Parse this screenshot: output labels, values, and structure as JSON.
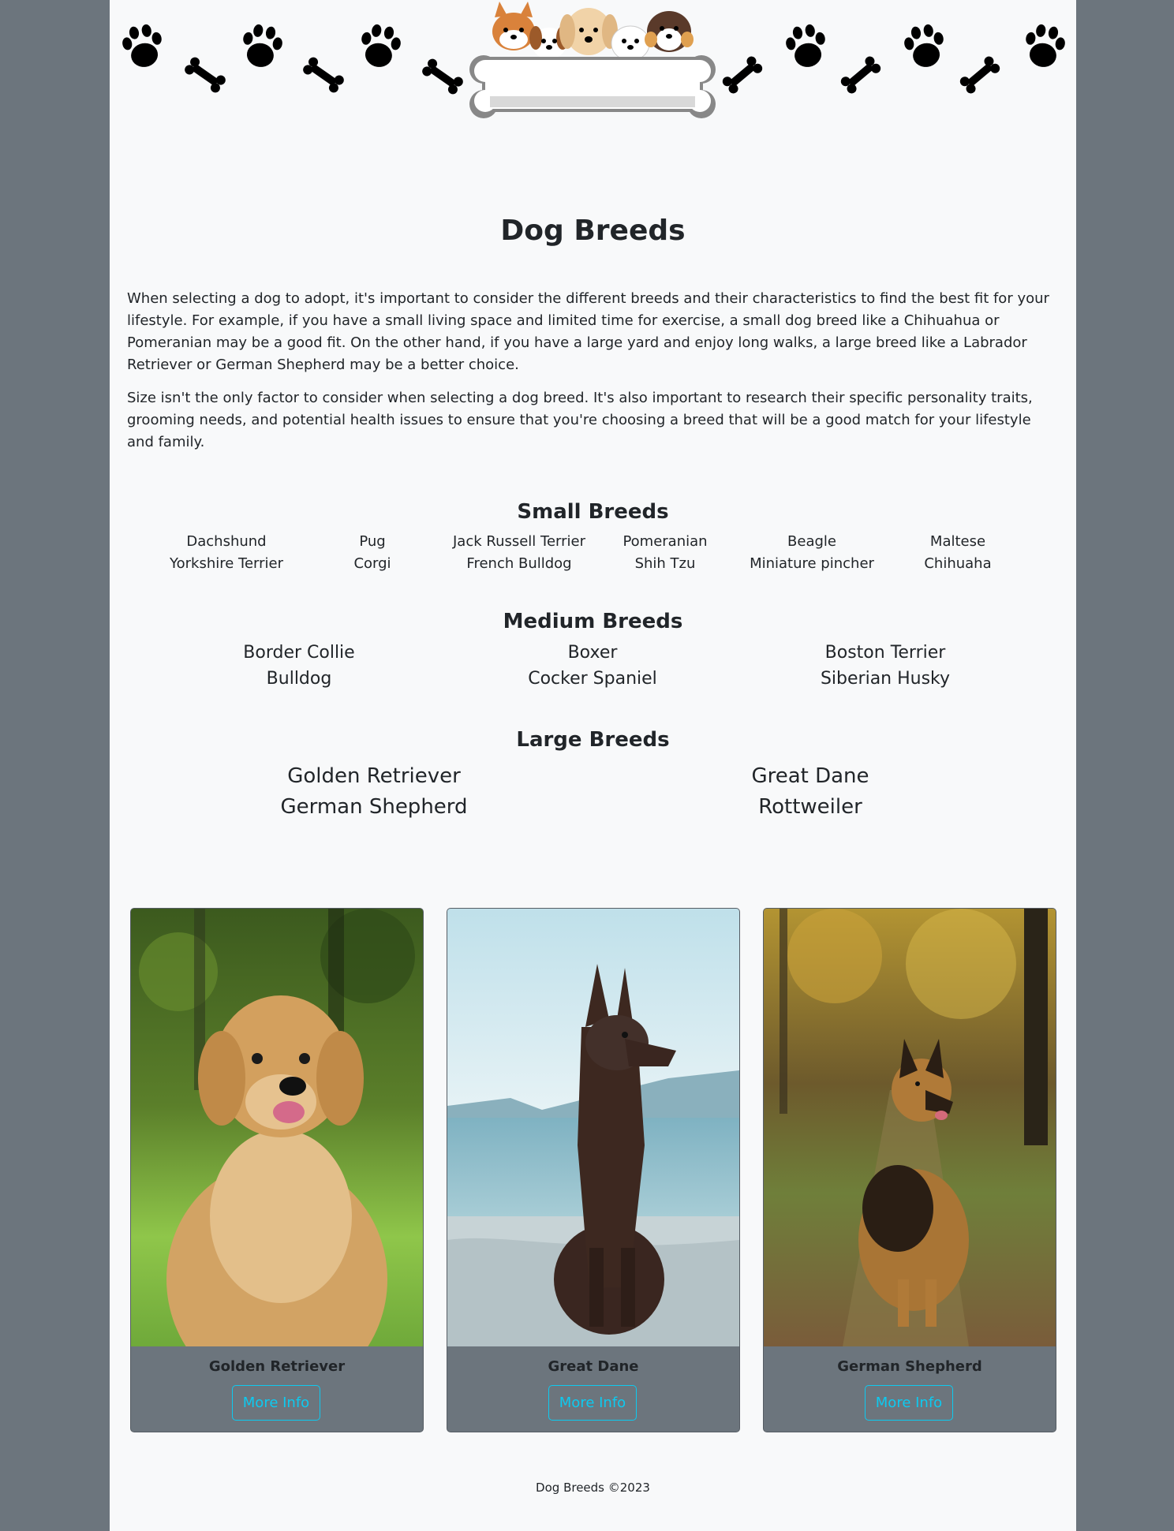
{
  "page": {
    "title": "Dog Breeds",
    "intro": [
      "When selecting a dog to adopt, it's important to consider the different breeds and their characteristics to find the best fit for your lifestyle. For example, if you have a small living space and limited time for exercise, a small dog breed like a Chihuahua or Pomeranian may be a good fit. On the other hand, if you have a large yard and enjoy long walks, a large breed like a Labrador Retriever or German Shepherd may be a better choice.",
      "Size isn't the only factor to consider when selecting a dog breed. It's also important to research their specific personality traits, grooming needs, and potential health issues to ensure that you're choosing a breed that will be a good match for your lifestyle and family."
    ]
  },
  "small": {
    "title": "Small Breeds",
    "breeds": [
      "Dachshund",
      "Pug",
      "Jack Russell Terrier",
      "Pomeranian",
      "Beagle",
      "Maltese",
      "Yorkshire Terrier",
      "Corgi",
      "French Bulldog",
      "Shih Tzu",
      "Miniature pincher",
      "Chihuaha"
    ]
  },
  "medium": {
    "title": "Medium Breeds",
    "breeds": [
      "Border Collie",
      "Boxer",
      "Boston Terrier",
      "Bulldog",
      "Cocker Spaniel",
      "Siberian Husky"
    ]
  },
  "large": {
    "title": "Large Breeds",
    "breeds": [
      "Golden Retriever",
      "Great Dane",
      "German Shepherd",
      "Rottweiler"
    ]
  },
  "cards": [
    {
      "name": "Golden Retriever",
      "button": "More Info"
    },
    {
      "name": "Great Dane",
      "button": "More Info"
    },
    {
      "name": "German Shepherd",
      "button": "More Info"
    }
  ],
  "footer": "Dog Breeds ©2023",
  "colors": {
    "outer": "#6c757d",
    "page": "#f8f9fa",
    "accent": "#0dcaf0"
  }
}
